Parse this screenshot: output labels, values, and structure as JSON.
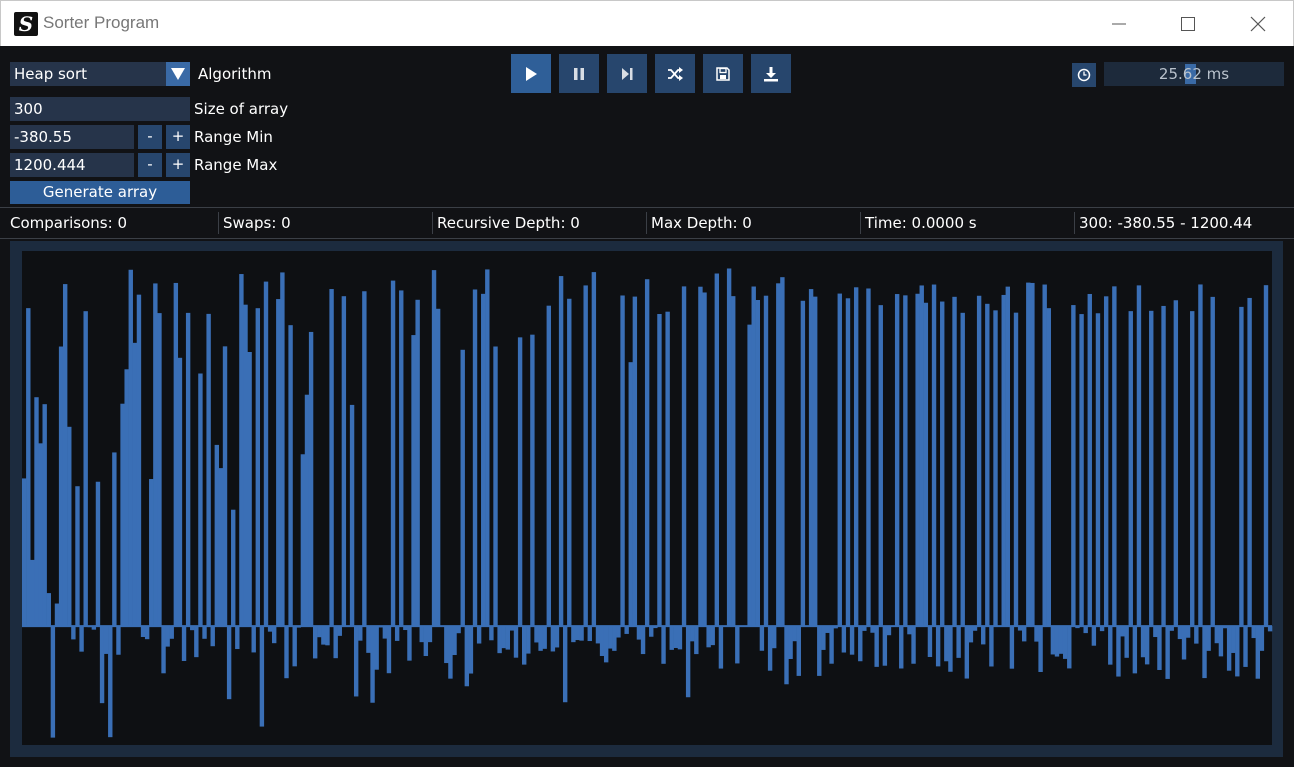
{
  "window": {
    "title": "Sorter Program",
    "app_icon": "S"
  },
  "controls": {
    "algorithm_value": "Heap sort",
    "algorithm_label": "Algorithm",
    "size_value": "300",
    "size_label": "Size of array",
    "range_min_value": "-380.55",
    "range_min_label": "Range Min",
    "range_max_value": "1200.444",
    "range_max_label": "Range Max",
    "minus": "-",
    "plus": "+",
    "generate_label": "Generate array",
    "delay_value": "25.62 ms",
    "delay_fraction": 0.48
  },
  "toolbar": {
    "icons": [
      "play-icon",
      "pause-icon",
      "step-icon",
      "shuffle-icon",
      "save-icon",
      "download-icon"
    ]
  },
  "stats": {
    "comparisons": "Comparisons: 0",
    "swaps": "Swaps: 0",
    "recursive_depth": "Recursive Depth: 0",
    "max_depth": "Max Depth: 0",
    "time": "Time: 0.0000 s",
    "summary": "300: -380.55 - 1200.44"
  },
  "colors": {
    "bar": "#3a6fb6",
    "accent": "#2f5f98",
    "field": "#26344a"
  },
  "chart_data": {
    "type": "bar",
    "count": 300,
    "ylim": [
      -380.55,
      1200.444
    ],
    "values": [
      472.6,
      1017.6,
      211.8,
      732.5,
      584.9,
      710.2,
      105.6,
      -356.9,
      72.2,
      894.7,
      1094.5,
      637.8,
      -42.6,
      447.6,
      -81.8,
      1007.8,
      -3.5,
      -11.4,
      462,
      -246.6,
      -89.1,
      -355.5,
      555.8,
      -91.7,
      711.7,
      821.9,
      1140.4,
      906.5,
      1060.7,
      -34.9,
      -41.9,
      470.7,
      1096.7,
      1001.7,
      -151.1,
      -65.7,
      -40.6,
      1098.2,
      858.6,
      -111.7,
      1002.4,
      -13.1,
      -99.4,
      808.4,
      -40.6,
      999.2,
      -64.4,
      579.9,
      505.6,
      895.3,
      -233.9,
      372.5,
      -73.4,
      1126.7,
      1028.6,
      877.2,
      -84.3,
      1017.4,
      -321.6,
      1102.5,
      -17.8,
      -54.7,
      1046.6,
      1131.9,
      -166.8,
      963.1,
      -128.8,
      -4.8,
      549.9,
      740.5,
      941.4,
      -103.5,
      -35.6,
      -59.3,
      -61.5,
      1078.7,
      -102.7,
      -31.3,
      1055.8,
      -0.8,
      707.9,
      -225.2,
      -46.7,
      1071.6,
      -85.7,
      -245.3,
      -139.6,
      -4.4,
      -40,
      -150.8,
      1105.7,
      -47.4,
      1074.3,
      -12.6,
      -110.6,
      931.4,
      1044.3,
      -51.4,
      -95.8,
      -51.4,
      1139.3,
      1015.5,
      -0.3,
      -118.3,
      -168.2,
      -92.6,
      -22.8,
      884.3,
      -192.6,
      -151.9,
      1077.3,
      -55.8,
      1063.3,
      1141.5,
      -45.4,
      894.8,
      -86.6,
      -70.6,
      -75.2,
      -14.3,
      -101.1,
      924.1,
      -123.3,
      -88,
      932.7,
      -52.4,
      -79.2,
      -72.8,
      1025.4,
      -81.2,
      -68.4,
      1120.2,
      -243.7,
      1047.6,
      -51.4,
      -44.7,
      -46.6,
      1090.3,
      -47.8,
      1132.9,
      -55.5,
      -95.7,
      -116.1,
      -71.9,
      -79.3,
      -36.6,
      1058.1,
      -25.1,
      844.6,
      1054.5,
      -43.2,
      -89.5,
      1110.1,
      -34.1,
      -6.4,
      998.8,
      -120.7,
      1006.2,
      -76.1,
      -70.1,
      -74.5,
      1087.2,
      -227.7,
      -48.8,
      -89.6,
      1086.2,
      1067.7,
      -67.9,
      -60.9,
      1128.4,
      -136,
      -2.6,
      1144.5,
      1056,
      -119.5,
      -2.7,
      -1,
      964.8,
      1086.8,
      1043.6,
      -79,
      1057.4,
      -142.8,
      -70.8,
      1097,
      1116.7,
      -186.2,
      -105.3,
      -48.4,
      -159.4,
      1041.1,
      -2.6,
      1078.6,
      1054.4,
      -159.4,
      -76.3,
      -22,
      -120.4,
      -7.3,
      1064.2,
      -84.6,
      1049.1,
      -91.5,
      1084.3,
      -112.5,
      -15.4,
      1080.5,
      -21.3,
      -130.5,
      1027.2,
      -126.8,
      -29.2,
      -2.3,
      1062.7,
      -135.7,
      1058.5,
      -26.3,
      -120.5,
      1063.6,
      1090.2,
      1034.8,
      -98.9,
      1093.1,
      -128.9,
      1038.7,
      -112.6,
      -146.1,
      1053.8,
      -101.7,
      1002.6,
      -167.9,
      -52.2,
      -15,
      1057.2,
      -58.6,
      1031.4,
      -129.3,
      1010.5,
      -0.8,
      1059.8,
      1086.4,
      -136.3,
      1003.1,
      -14.3,
      -49,
      1099.3,
      1098.2,
      -49.7,
      -146.9,
      1093.1,
      1017.5,
      -90.8,
      -97.5,
      -88.7,
      -105,
      -135.5,
      1027.4,
      -6.5,
      998.6,
      -22.4,
      1062.9,
      -62.8,
      1001.2,
      -16.1,
      1055.4,
      -123.4,
      1087.3,
      -161.5,
      -33.1,
      -101.5,
      1008,
      -151.3,
      1090.4,
      -99.7,
      -122.6,
      1009,
      -35,
      -140.5,
      1024.6,
      -169.1,
      -15.1,
      1042.8,
      -41.5,
      -106.9,
      -37.3,
      1008,
      -56.1,
      1093.4,
      -166.4,
      -79.3,
      1053.6,
      -54.8,
      -96.9,
      -6.9,
      -142.8,
      -86,
      -161.1,
      1021.6,
      -130.7,
      1050.2,
      -38.3,
      -168.4,
      -79.2,
      1091.1,
      -16.9
    ]
  }
}
